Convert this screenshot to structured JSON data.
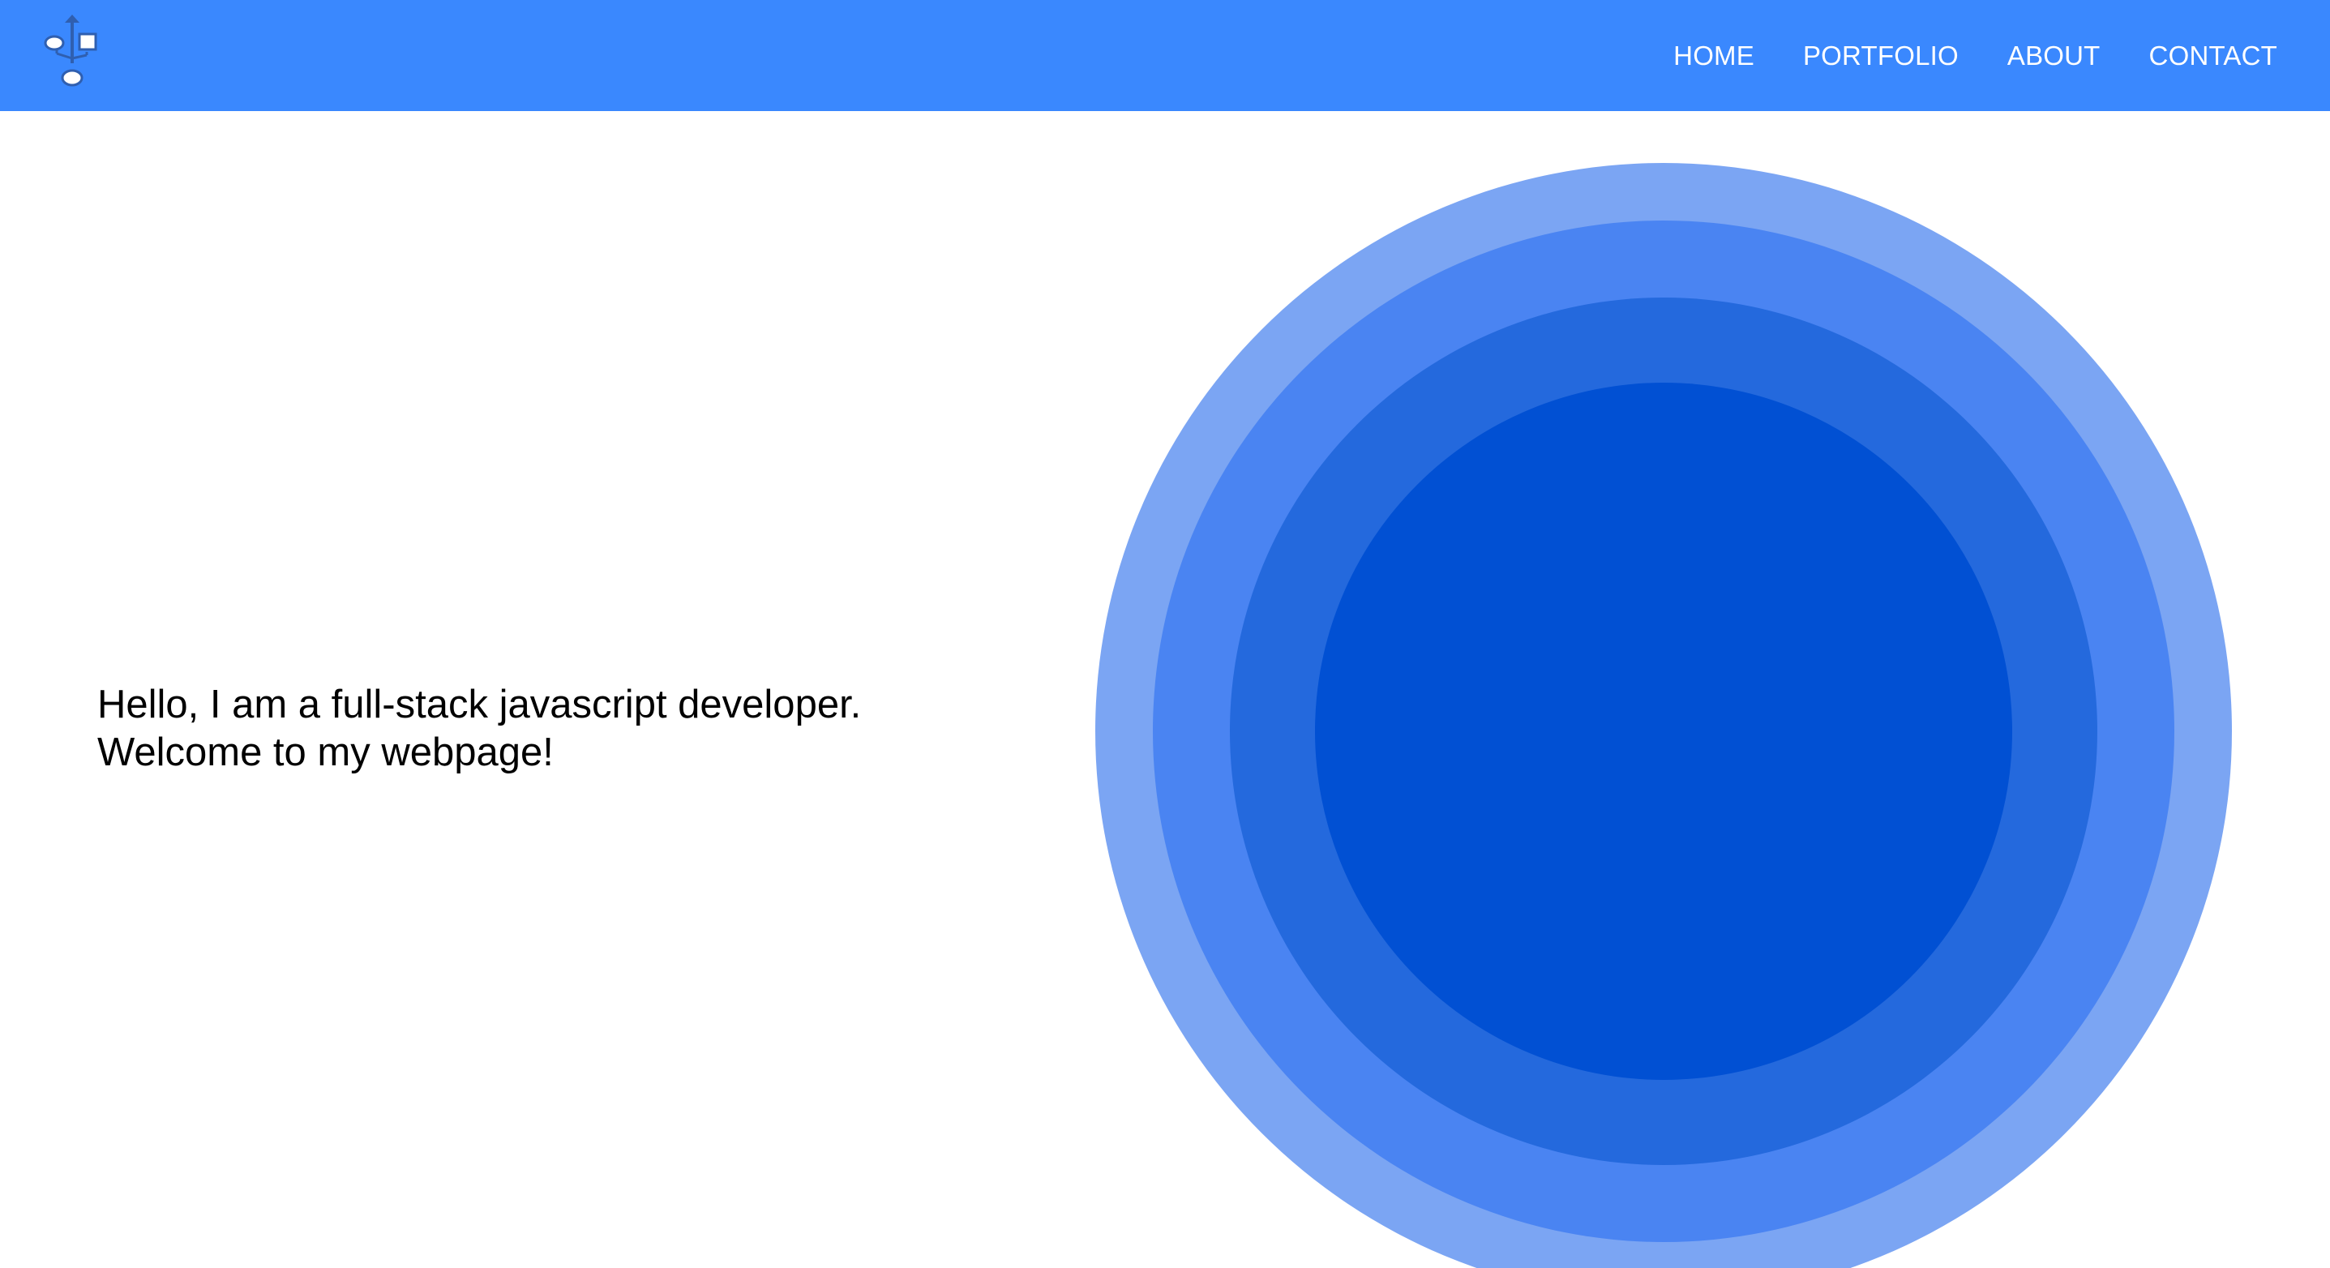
{
  "colors": {
    "navbar_bg": "#3a88fe",
    "nav_text": "#ffffff",
    "hero_text": "#000000",
    "ring_1": "#7ba5f3",
    "ring_2": "#4a84f2",
    "ring_3": "#2469dd",
    "ring_4": "#0150d3"
  },
  "header": {
    "logo_icon": "flowchart-icon",
    "nav": [
      {
        "label": "HOME"
      },
      {
        "label": "PORTFOLIO"
      },
      {
        "label": "ABOUT"
      },
      {
        "label": "CONTACT"
      }
    ]
  },
  "hero": {
    "line1": "Hello, I am a full-stack javascript developer.",
    "line2": "Welcome to my webpage!"
  },
  "graphic": {
    "icon": "concentric-circles-icon"
  }
}
